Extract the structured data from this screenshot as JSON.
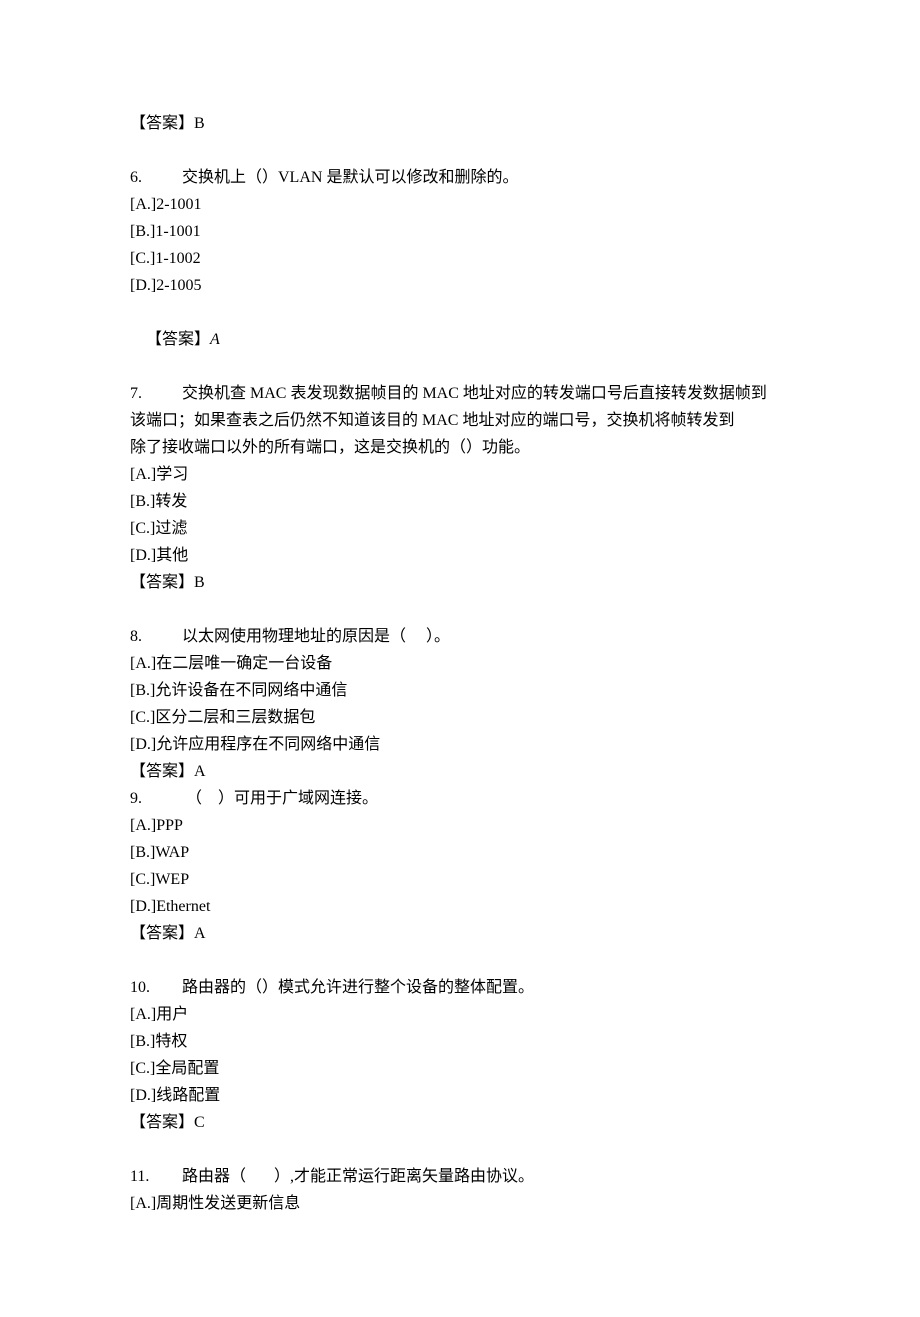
{
  "ans5": "【答案】B",
  "q6": {
    "num": "6. ",
    "text": "交换机上（）VLAN 是默认可以修改和删除的。",
    "A": "[A.]2-1001",
    "B": "[B.]1-1001",
    "C": "[C.]1-1002",
    "D": "[D.]2-1005",
    "ans_label": "【答案】",
    "ans_val": "A"
  },
  "q7": {
    "num": "7. ",
    "l1": "交换机查 MAC 表发现数据帧目的 MAC 地址对应的转发端口号后直接转发数据帧到",
    "l2": "该端口；如果查表之后仍然不知道该目的 MAC 地址对应的端口号，交换机将帧转发到",
    "l3": "除了接收端口以外的所有端口，这是交换机的（）功能。",
    "A": "[A.]学习",
    "B": "[B.]转发",
    "C": "[C.]过滤",
    "D": "[D.]其他",
    "ans": "【答案】B"
  },
  "q8": {
    "num": "8. ",
    "text": "以太网使用物理地址的原因是（     ）。",
    "A": "[A.]在二层唯一确定一台设备",
    "B": "[B.]允许设备在不同网络中通信",
    "C": "[C.]区分二层和三层数据包",
    "D": "[D.]允许应用程序在不同网络中通信",
    "ans": "【答案】A"
  },
  "q9": {
    "num": "9. ",
    "text": " （    ）可用于广域网连接。",
    "A": "[A.]PPP",
    "B": "[B.]WAP",
    "C": "[C.]WEP",
    "D": "[D.]Ethernet",
    "ans": "【答案】A"
  },
  "q10": {
    "num": "10. ",
    "text": "路由器的（）模式允许进行整个设备的整体配置。",
    "A": "[A.]用户",
    "B": "[B.]特权",
    "C": "[C.]全局配置",
    "D": "[D.]线路配置",
    "ans": "【答案】C"
  },
  "q11": {
    "num": "11. ",
    "text": "路由器（       ）,才能正常运行距离矢量路由协议。",
    "A": "[A.]周期性发送更新信息"
  }
}
